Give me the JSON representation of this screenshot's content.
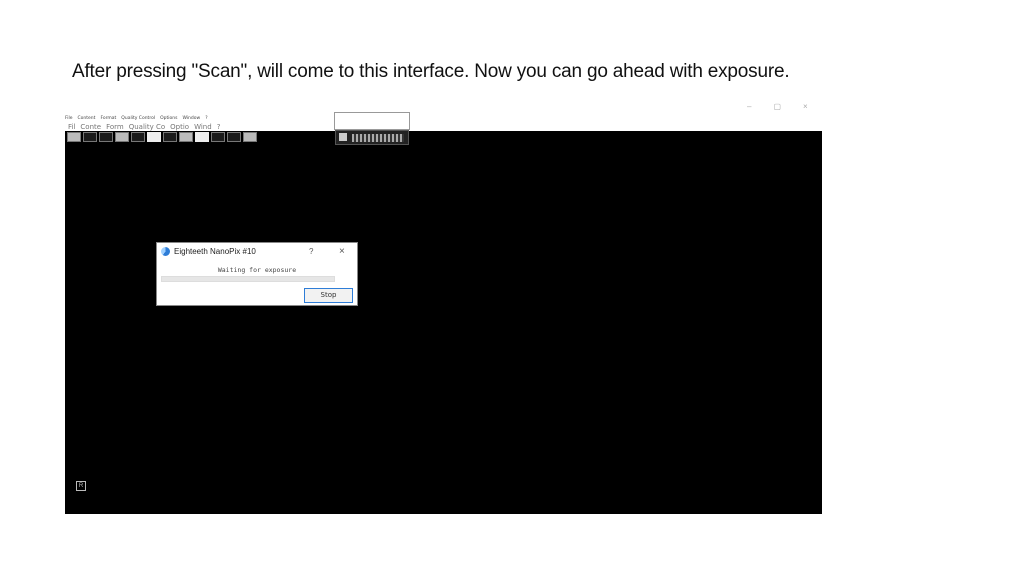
{
  "caption": "After pressing \"Scan\", will come to this interface. Now you can go ahead with exposure.",
  "menu": [
    "File",
    "Content",
    "Format",
    "Quality Control",
    "Options",
    "Window",
    "?"
  ],
  "groups": [
    "Fil",
    "Conte",
    "Form",
    "Quality Co",
    "Optio",
    "Wind",
    "?"
  ],
  "window_controls": {
    "minimize": "–",
    "maximize": "▢",
    "close": "×"
  },
  "dialog": {
    "title": "Eighteeth NanoPix #10",
    "help": "?",
    "close": "×",
    "message": "Waiting for exposure",
    "stop_label": "Stop"
  },
  "corner_box_label": "R"
}
